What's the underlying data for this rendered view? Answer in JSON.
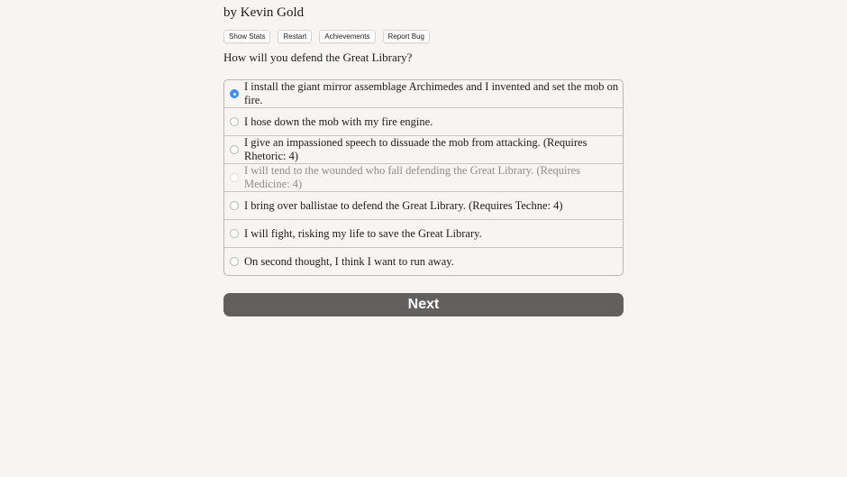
{
  "header": {
    "byline": "by Kevin Gold"
  },
  "toolbar": {
    "buttons": [
      {
        "label": "Show Stats"
      },
      {
        "label": "Restart"
      },
      {
        "label": "Achievements"
      },
      {
        "label": "Report Bug"
      }
    ]
  },
  "question": "How will you defend the Great Library?",
  "choices": [
    {
      "label": "I install the giant mirror assemblage Archimedes and I invented and set the mob on fire.",
      "selected": true,
      "disabled": false
    },
    {
      "label": "I hose down the mob with my fire engine.",
      "selected": false,
      "disabled": false
    },
    {
      "label": "I give an impassioned speech to dissuade the mob from attacking. (Requires Rhetoric: 4)",
      "selected": false,
      "disabled": false
    },
    {
      "label": "I will tend to the wounded who fall defending the Great Library. (Requires Medicine: 4)",
      "selected": false,
      "disabled": true
    },
    {
      "label": "I bring over ballistae to defend the Great Library. (Requires Techne: 4)",
      "selected": false,
      "disabled": false
    },
    {
      "label": "I will fight, risking my life to save the Great Library.",
      "selected": false,
      "disabled": false
    },
    {
      "label": "On second thought, I think I want to run away.",
      "selected": false,
      "disabled": false
    }
  ],
  "next_button": {
    "label": "Next"
  },
  "colors": {
    "background": "#f7f4f1",
    "radio_selected": "#3d8ef3",
    "next_button": "#62605e",
    "disabled_text": "#8f8d8b"
  }
}
